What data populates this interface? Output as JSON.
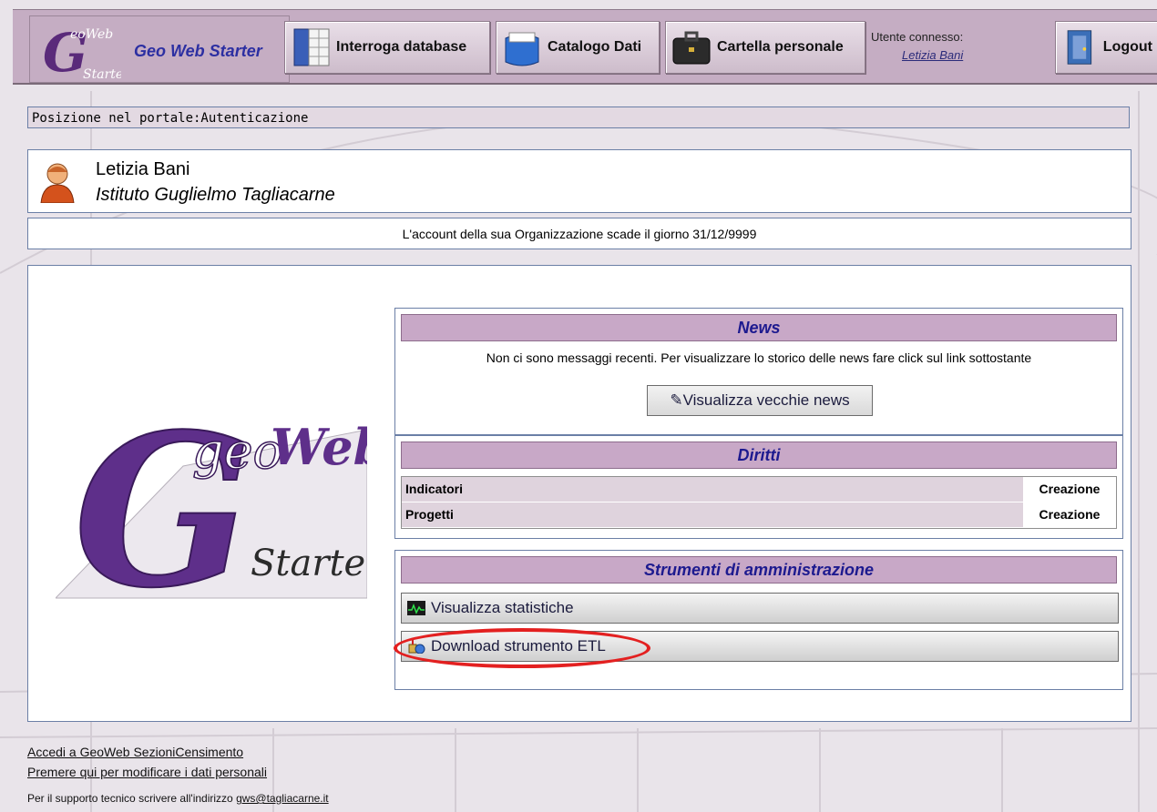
{
  "app": {
    "title": "Geo Web Starter"
  },
  "toolbar": {
    "query_db": "Interroga database",
    "catalog": "Catalogo Dati",
    "personal_folder": "Cartella personale",
    "logout": "Logout"
  },
  "user": {
    "connected_label": "Utente connesso:",
    "connected_name": "Letizia Bani",
    "full_name": "Letizia Bani",
    "organization": "Istituto Guglielmo Tagliacarne"
  },
  "breadcrumb": "Posizione nel portale:Autenticazione",
  "account_expiry": "L'account della sua Organizzazione scade il giorno 31/12/9999",
  "news": {
    "title": "News",
    "message": "Non ci sono messaggi recenti. Per visualizzare lo storico delle news fare click sul link sottostante",
    "old_news_button": "Visualizza vecchie news"
  },
  "rights": {
    "title": "Diritti",
    "rows": [
      {
        "name": "Indicatori",
        "value": "Creazione"
      },
      {
        "name": "Progetti",
        "value": "Creazione"
      }
    ]
  },
  "admin_tools": {
    "title": "Strumenti di amministrazione",
    "stats_button": "Visualizza statistiche",
    "etl_button": "Download strumento ETL"
  },
  "footer": {
    "link_census": "Accedi a GeoWeb SezioniCensimento",
    "link_personal": "Premere qui per modificare i dati personali",
    "support_text": "Per il supporto tecnico scrivere all'indirizzo",
    "support_email": "gws@tagliacarne.it"
  },
  "big_logo": {
    "word1": "geo",
    "word2": "Web",
    "word3": "Starter"
  },
  "colors": {
    "toolbar_bg": "#c5adc3",
    "section_header": "#c8a8c7",
    "header_text": "#1d1a8f",
    "highlight": "#e32020"
  }
}
